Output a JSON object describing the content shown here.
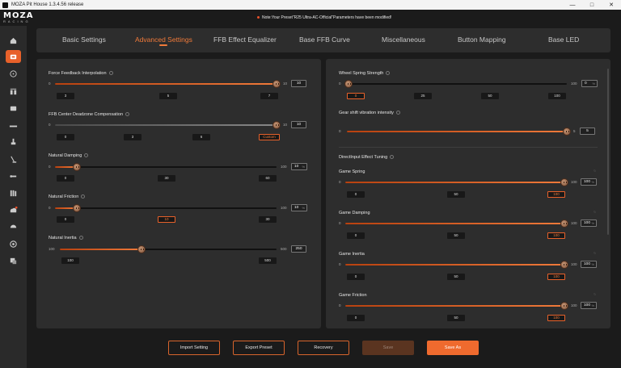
{
  "window": {
    "title": "MOZA Pit House 1.3.4.56 release"
  },
  "header": {
    "brand": "MOZA",
    "brand_sub": "RACING",
    "notice": "Note:Your Preset\"R25 Ultra-AC-Official\"Parameters have been modified!"
  },
  "tabs": [
    {
      "label": "Basic Settings",
      "active": false
    },
    {
      "label": "Advanced Settings",
      "active": true
    },
    {
      "label": "FFB Effect Equalizer",
      "active": false
    },
    {
      "label": "Base FFB Curve",
      "active": false
    },
    {
      "label": "Miscellaneous",
      "active": false
    },
    {
      "label": "Button Mapping",
      "active": false
    },
    {
      "label": "Base LED",
      "active": false
    }
  ],
  "sidebar": {
    "icons": [
      "home-icon",
      "wheelbase-icon",
      "steering-wheel-icon",
      "pedals-icon",
      "dashboard-icon",
      "shifter-icon",
      "handbrake-icon",
      "stalk-icon",
      "sequential-icon",
      "hub-icon",
      "updates-icon",
      "cloud-icon",
      "speed-icon",
      "settings-icon",
      "feedback-icon"
    ],
    "active_index": 1
  },
  "left": {
    "ffb_interp": {
      "title": "Force Feedback Interpolation",
      "min": "0",
      "max": "10",
      "value": 10,
      "display": "10",
      "presets": [
        "3",
        "5",
        "7"
      ]
    },
    "deadzone": {
      "title": "FFB Center Deadzone Compensation",
      "min": "0",
      "max": "10",
      "value": 10,
      "display": "10",
      "presets": [
        "0",
        "3",
        "6",
        "Custom"
      ]
    },
    "damping": {
      "title": "Natural Damping",
      "min": "0",
      "max": "100",
      "value": 10,
      "display": "10",
      "unit": "%",
      "presets": [
        "0",
        "30",
        "60"
      ]
    },
    "friction": {
      "title": "Natural Friction",
      "min": "0",
      "max": "100",
      "value": 10,
      "display": "10",
      "unit": "%",
      "presets": [
        "0",
        "10",
        "30"
      ]
    },
    "inertia": {
      "title": "Natural Inertia",
      "min": "100",
      "max": "500",
      "value": 250,
      "display": "250",
      "presets": [
        "100",
        "500"
      ]
    }
  },
  "right": {
    "spring": {
      "title": "Wheel Spring Strength",
      "min": "0",
      "max": "100",
      "value": 0,
      "display": "0",
      "unit": "%",
      "presets": [
        "0",
        "25",
        "50",
        "100"
      ]
    },
    "gear": {
      "title": "Gear shift vibration intensity",
      "min": "0",
      "max": "5",
      "value": 5,
      "display": "5"
    },
    "directinput": {
      "title": "DirectInput Effect Tuning"
    },
    "game_spring": {
      "title": "Game Spring",
      "min": "0",
      "max": "100",
      "value": 100,
      "display": "100",
      "unit": "%",
      "presets": [
        "0",
        "50",
        "100"
      ]
    },
    "game_damping": {
      "title": "Game Damping",
      "min": "0",
      "max": "100",
      "value": 100,
      "display": "100",
      "unit": "%",
      "presets": [
        "0",
        "50",
        "100"
      ]
    },
    "game_inertia": {
      "title": "Game Inertia",
      "min": "0",
      "max": "100",
      "value": 100,
      "display": "100",
      "unit": "%",
      "presets": [
        "0",
        "50",
        "100"
      ]
    },
    "game_friction": {
      "title": "Game Friction",
      "min": "0",
      "max": "100",
      "value": 100,
      "display": "100",
      "unit": "%",
      "presets": [
        "0",
        "50",
        "100"
      ]
    }
  },
  "buttons": {
    "import": "Import Setting",
    "export": "Export Preset",
    "recovery": "Recovery",
    "save": "Save",
    "save_as": "Save As"
  },
  "colors": {
    "accent": "#f07a3a",
    "accent_dark": "#b8410f",
    "panel": "#2d2d2d",
    "background": "#1b1b1b"
  }
}
